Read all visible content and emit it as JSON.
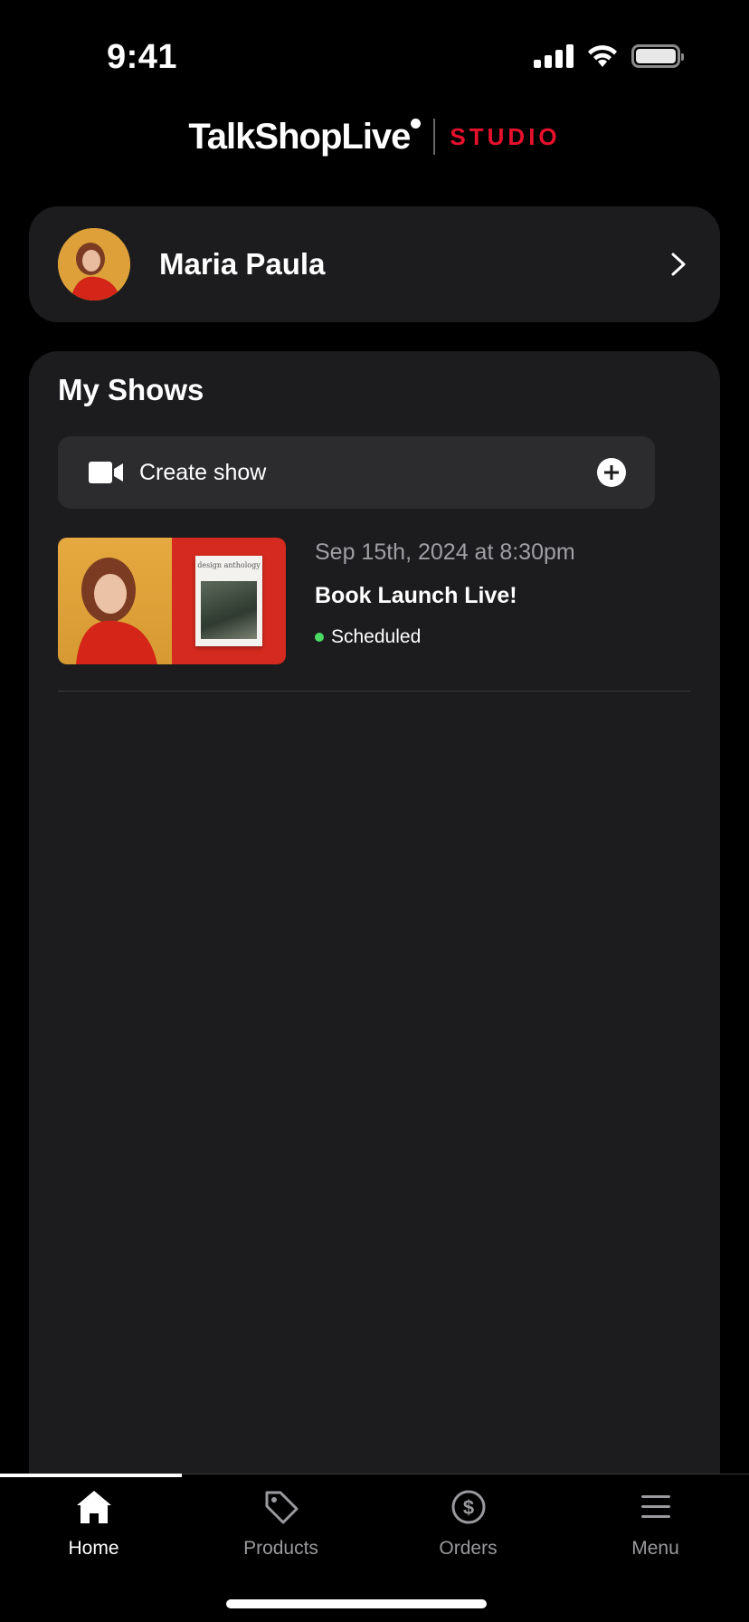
{
  "status_bar": {
    "time": "9:41",
    "icons": [
      "signal-icon",
      "wifi-icon",
      "battery-icon"
    ]
  },
  "logo": {
    "brand": "TalkShopLive",
    "product": "STUDIO",
    "accent_color": "#e8112d"
  },
  "profile": {
    "name": "Maria Paula"
  },
  "shows": {
    "title": "My Shows",
    "create_label": "Create show",
    "items": [
      {
        "date": "Sep 15th, 2024 at 8:30pm",
        "title": "Book Launch Live!",
        "status": "Scheduled",
        "status_color": "#4cd964",
        "book_cover_text": "design anthology"
      }
    ]
  },
  "tabs": [
    {
      "label": "Home",
      "icon": "home-icon",
      "active": true
    },
    {
      "label": "Products",
      "icon": "tag-icon",
      "active": false
    },
    {
      "label": "Orders",
      "icon": "dollar-icon",
      "active": false
    },
    {
      "label": "Menu",
      "icon": "menu-icon",
      "active": false
    }
  ]
}
